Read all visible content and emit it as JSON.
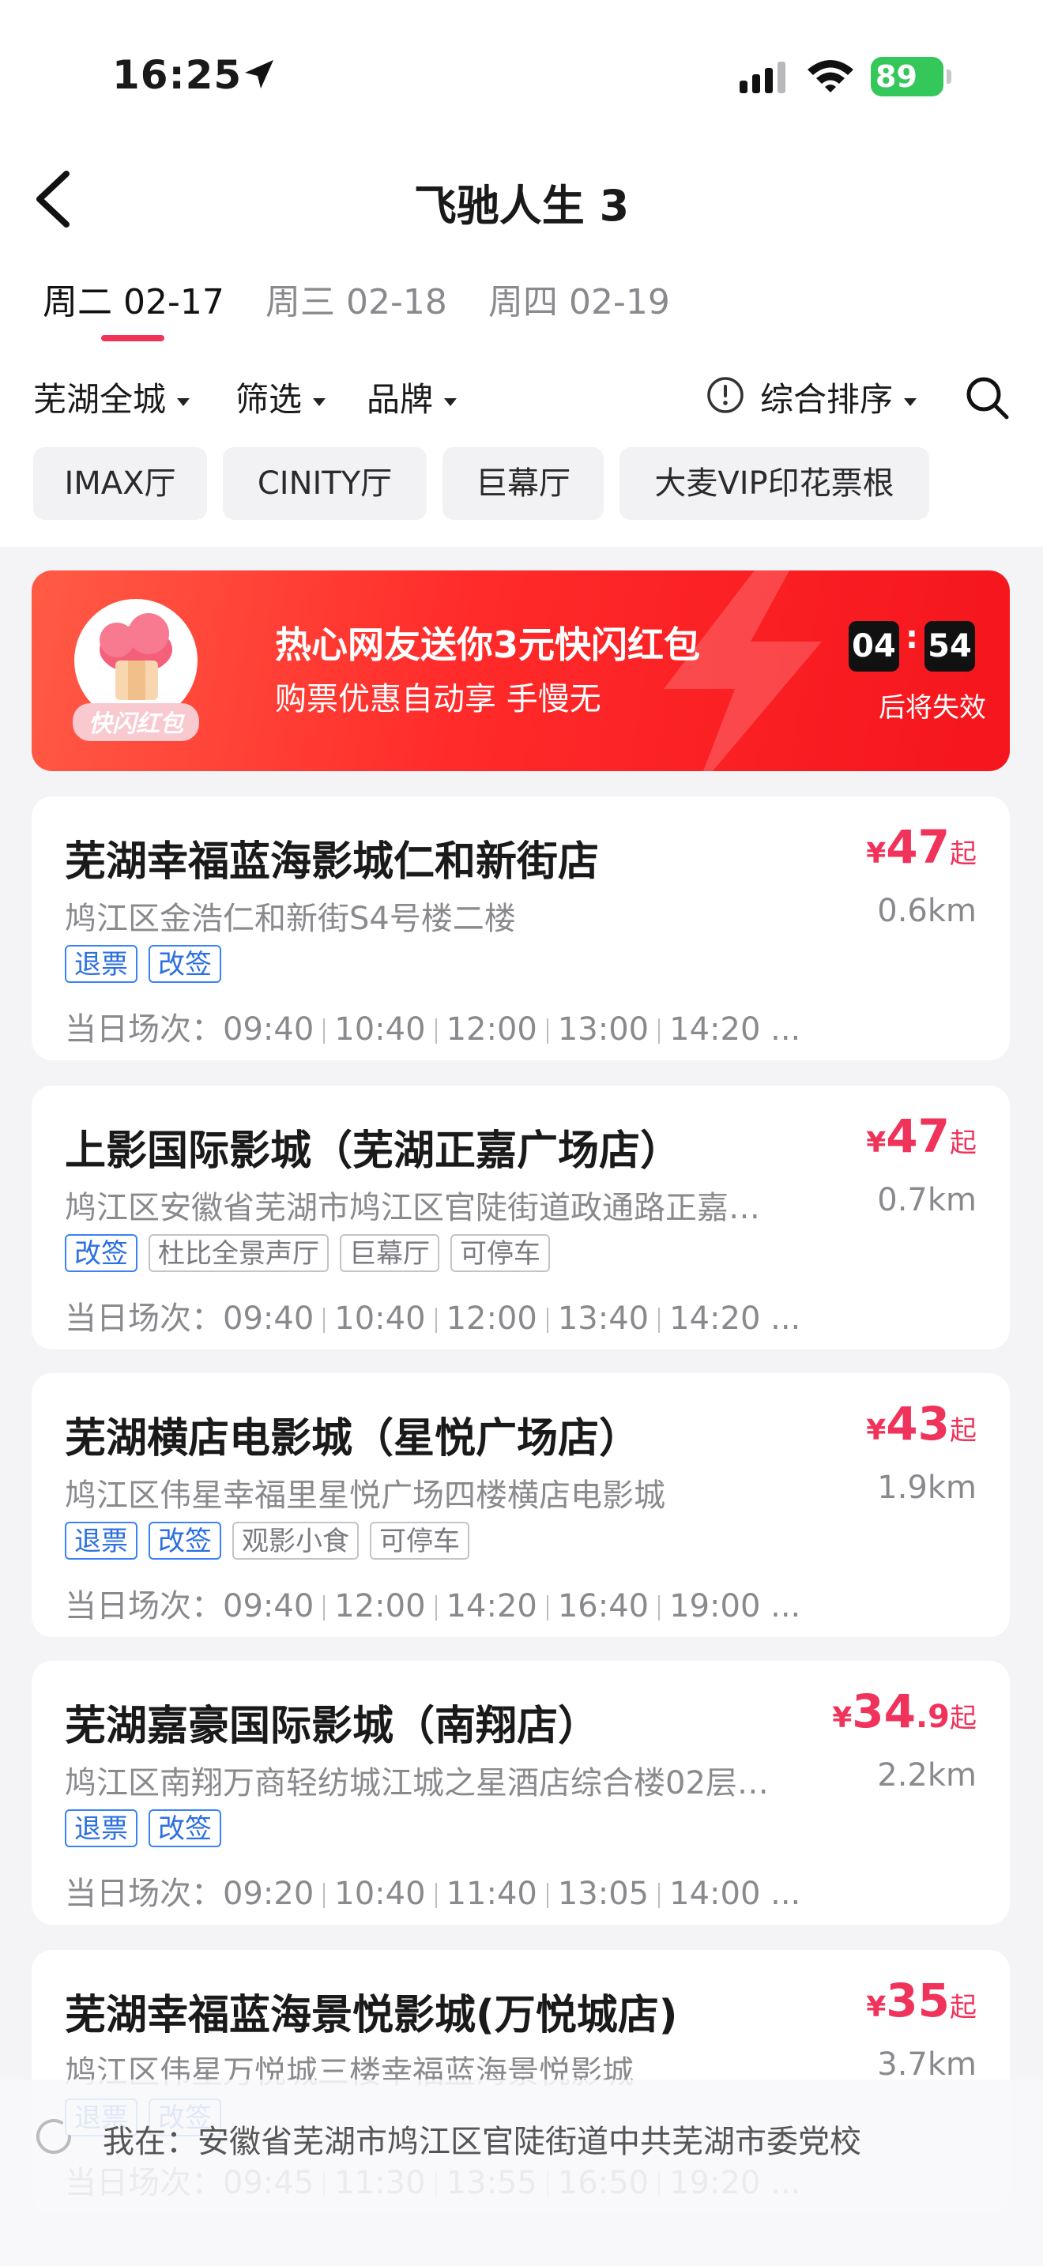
{
  "status_bar": {
    "time": "16:25",
    "battery": "89"
  },
  "nav": {
    "title": "飞驰人生 3"
  },
  "dates": [
    {
      "label": "周二 02-17",
      "active": true
    },
    {
      "label": "周三 02-18",
      "active": false
    },
    {
      "label": "周四 02-19",
      "active": false
    }
  ],
  "filters": {
    "city": "芜湖全城",
    "filter": "筛选",
    "brand": "品牌",
    "sort": "综合排序"
  },
  "chips": [
    "IMAX厅",
    "CINITY厅",
    "巨幕厅",
    "大麦VIP印花票根"
  ],
  "banner": {
    "logo_text": "快闪红包",
    "title": "热心网友送你3元快闪红包",
    "subtitle": "购票优惠自动享 手慢无",
    "countdown_min": "04",
    "countdown_sec": "54",
    "countdown_label": "后将失效"
  },
  "cinemas": [
    {
      "name": "芜湖幸福蓝海影城仁和新街店",
      "price_symbol": "¥",
      "price_int": "47",
      "price_dec": "",
      "price_suffix": "起",
      "address": "鸠江区金浩仁和新街S4号楼二楼",
      "distance": "0.6km",
      "tags": [
        {
          "text": "退票",
          "style": "blue"
        },
        {
          "text": "改签",
          "style": "blue"
        }
      ],
      "times_label": "当日场次：",
      "times": [
        "09:40",
        "10:40",
        "12:00",
        "13:00",
        "14:20 ..."
      ]
    },
    {
      "name": "上影国际影城（芜湖正嘉广场店）",
      "price_symbol": "¥",
      "price_int": "47",
      "price_dec": "",
      "price_suffix": "起",
      "address": "鸠江区安徽省芜湖市鸠江区官陡街道政通路正嘉…",
      "distance": "0.7km",
      "tags": [
        {
          "text": "改签",
          "style": "blue"
        },
        {
          "text": "杜比全景声厅",
          "style": "gray"
        },
        {
          "text": "巨幕厅",
          "style": "gray"
        },
        {
          "text": "可停车",
          "style": "gray"
        }
      ],
      "times_label": "当日场次：",
      "times": [
        "09:40",
        "10:40",
        "12:00",
        "13:40",
        "14:20 ..."
      ]
    },
    {
      "name": "芜湖横店电影城（星悦广场店）",
      "price_symbol": "¥",
      "price_int": "43",
      "price_dec": "",
      "price_suffix": "起",
      "address": "鸠江区伟星幸福里星悦广场四楼横店电影城",
      "distance": "1.9km",
      "tags": [
        {
          "text": "退票",
          "style": "blue"
        },
        {
          "text": "改签",
          "style": "blue"
        },
        {
          "text": "观影小食",
          "style": "gray"
        },
        {
          "text": "可停车",
          "style": "gray"
        }
      ],
      "times_label": "当日场次：",
      "times": [
        "09:40",
        "12:00",
        "14:20",
        "16:40",
        "19:00 ..."
      ]
    },
    {
      "name": "芜湖嘉豪国际影城（南翔店）",
      "price_symbol": "¥",
      "price_int": "34",
      "price_dec": ".9",
      "price_suffix": "起",
      "address": "鸠江区南翔万商轻纺城江城之星酒店综合楼02层…",
      "distance": "2.2km",
      "tags": [
        {
          "text": "退票",
          "style": "blue"
        },
        {
          "text": "改签",
          "style": "blue"
        }
      ],
      "times_label": "当日场次：",
      "times": [
        "09:20",
        "10:40",
        "11:40",
        "13:05",
        "14:00 ..."
      ]
    },
    {
      "name": "芜湖幸福蓝海景悦影城(万悦城店)",
      "price_symbol": "¥",
      "price_int": "35",
      "price_dec": "",
      "price_suffix": "起",
      "address": "鸠江区伟星万悦城三楼幸福蓝海景悦影城",
      "distance": "3.7km",
      "tags": [
        {
          "text": "退票",
          "style": "blue"
        },
        {
          "text": "改签",
          "style": "blue"
        }
      ],
      "times_label": "当日场次：",
      "times": [
        "09:45",
        "11:30",
        "13:55",
        "16:50",
        "19:20 ..."
      ]
    }
  ],
  "location_bar": {
    "text": "我在：安徽省芜湖市鸠江区官陡街道中共芜湖市委党校"
  }
}
